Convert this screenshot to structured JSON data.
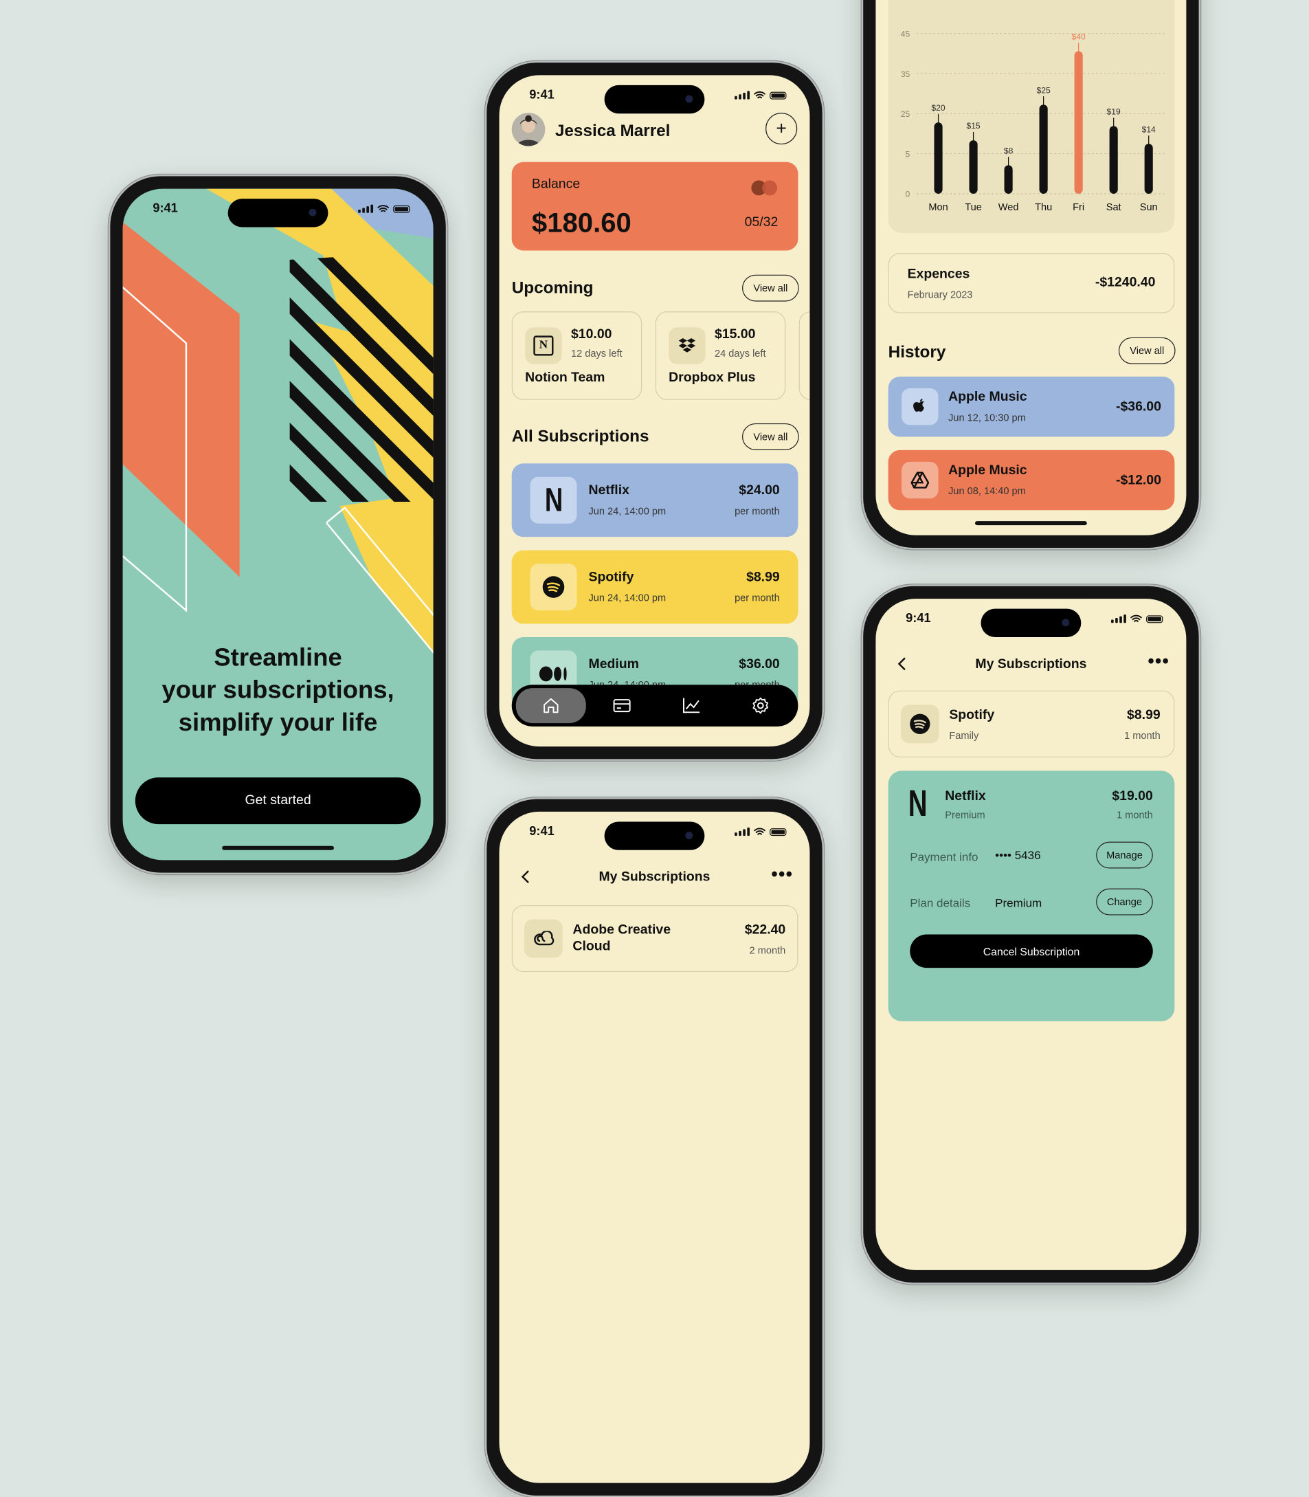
{
  "status_time": "9:41",
  "onboarding": {
    "headline_1": "Streamline",
    "headline_2": "your subscriptions,",
    "headline_3": "simplify your life",
    "cta_label": "Get started"
  },
  "dashboard": {
    "user_name": "Jessica Marrel",
    "balance_label": "Balance",
    "balance_amount": "$180.60",
    "card_expiry": "05/32",
    "upcoming_title": "Upcoming",
    "view_all": "View all",
    "upcoming": [
      {
        "name": "Notion Team",
        "price": "$10.00",
        "days": "12 days left",
        "icon": "notion-icon"
      },
      {
        "name": "Dropbox Plus",
        "price": "$15.00",
        "days": "24 days left",
        "icon": "dropbox-icon"
      }
    ],
    "all_subs_title": "All Subscriptions",
    "subscriptions": [
      {
        "name": "Netflix",
        "date": "Jun 24, 14:00 pm",
        "price": "$24.00",
        "period": "per month",
        "color": "#9bb5dc",
        "icon": "netflix-icon"
      },
      {
        "name": "Spotify",
        "date": "Jun 24, 14:00 pm",
        "price": "$8.99",
        "period": "per month",
        "color": "#f7d44c",
        "icon": "spotify-icon"
      },
      {
        "name": "Medium",
        "date": "Jun 24, 14:00 pm",
        "price": "$36.00",
        "period": "per month",
        "color": "#8dcbb6",
        "icon": "medium-icon"
      }
    ],
    "nav": [
      "home-icon",
      "card-icon",
      "chart-icon",
      "settings-icon"
    ]
  },
  "stats": {
    "chart_data": {
      "type": "bar",
      "categories": [
        "Mon",
        "Tue",
        "Wed",
        "Thu",
        "Fri",
        "Sat",
        "Sun"
      ],
      "values": [
        20,
        15,
        8,
        25,
        40,
        19,
        14
      ],
      "value_labels": [
        "$20",
        "$15",
        "$8",
        "$25",
        "$40",
        "$19",
        "$14"
      ],
      "highlight_index": 4,
      "highlight_color": "#ec7b55",
      "bar_color": "#111111",
      "yticks": [
        "0",
        "5",
        "25",
        "35",
        "45"
      ],
      "grid": true
    },
    "expenses_title": "Expences",
    "expenses_period": "February 2023",
    "expenses_amount": "-$1240.40",
    "history_title": "History",
    "view_all": "View all",
    "history": [
      {
        "name": "Apple Music",
        "date": "Jun 12, 10:30 pm",
        "amount": "-$36.00",
        "color": "#9bb5dc",
        "icon": "apple-icon"
      },
      {
        "name": "Apple Music",
        "date": "Jun 08, 14:40 pm",
        "amount": "-$12.00",
        "color": "#ec7b55",
        "icon": "google-drive-icon"
      }
    ]
  },
  "list_small": {
    "title": "My Subscriptions",
    "item_name_1": "Adobe Creative",
    "item_name_2": "Cloud",
    "item_price": "$22.40",
    "item_period": "2 month"
  },
  "detail": {
    "title": "My Subscriptions",
    "spotify_name": "Spotify",
    "spotify_plan": "Family",
    "spotify_price": "$8.99",
    "spotify_period": "1 month",
    "netflix_name": "Netflix",
    "netflix_plan": "Premium",
    "netflix_price": "$19.00",
    "netflix_period": "1 month",
    "payment_label": "Payment info",
    "payment_value": "•••• 5436",
    "manage_label": "Manage",
    "plan_label": "Plan details",
    "plan_value": "Premium",
    "change_label": "Change",
    "cancel_label": "Cancel Subscription"
  }
}
